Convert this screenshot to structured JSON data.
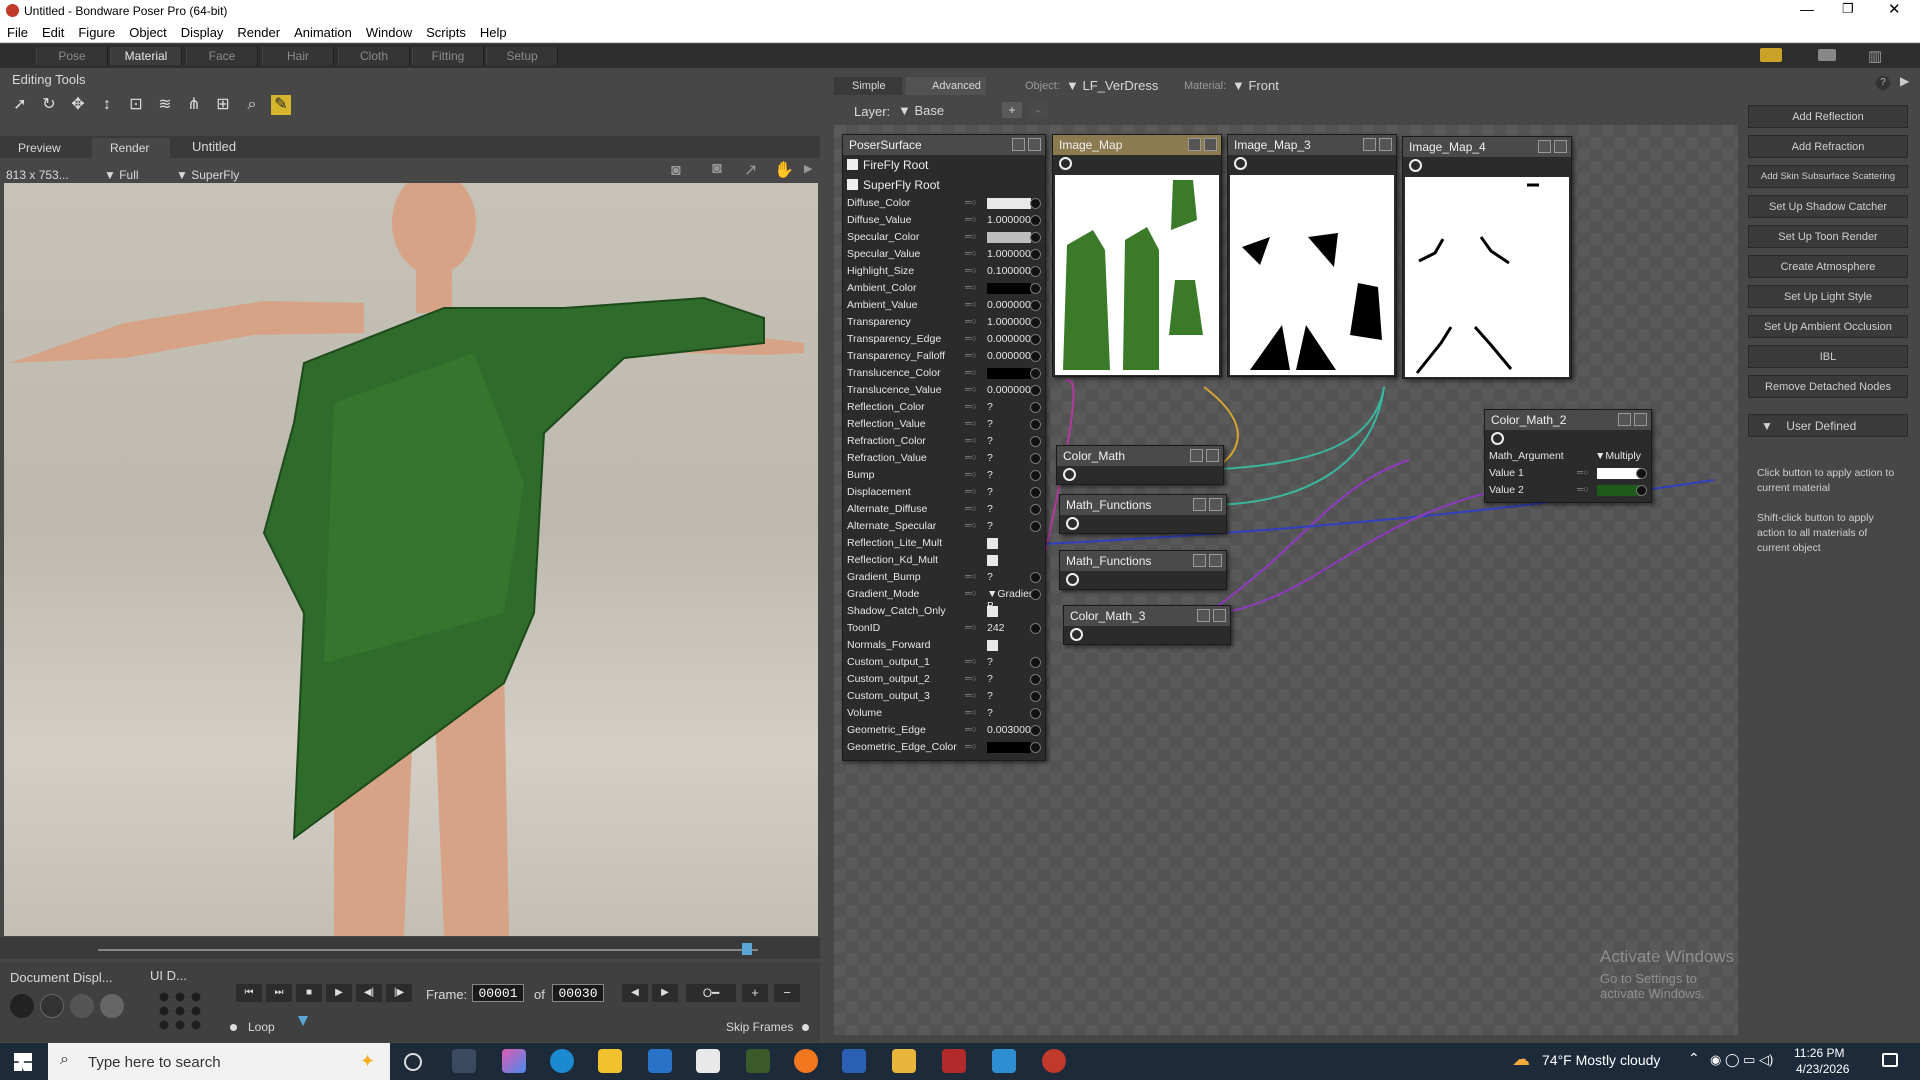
{
  "window": {
    "title": "Untitled - Bondware Poser Pro  (64-bit)"
  },
  "menu": [
    "File",
    "Edit",
    "Figure",
    "Object",
    "Display",
    "Render",
    "Animation",
    "Window",
    "Scripts",
    "Help"
  ],
  "rooms": [
    "Pose",
    "Material",
    "Face",
    "Hair",
    "Cloth",
    "Fitting",
    "Setup"
  ],
  "active_room": "Material",
  "editing_tools": {
    "label": "Editing Tools"
  },
  "doc_tabs": {
    "preview": "Preview",
    "render": "Render",
    "untitled": "Untitled"
  },
  "viewport": {
    "size": "813 x 753...",
    "mode": "Full",
    "renderer": "SuperFly"
  },
  "material_tabs": {
    "simple": "Simple",
    "advanced": "Advanced"
  },
  "object": {
    "label": "Object:",
    "value": "LF_VerDress"
  },
  "material": {
    "label": "Material:",
    "value": "Front"
  },
  "layer": {
    "label": "Layer:",
    "value": "Base"
  },
  "poser_surface": {
    "title": "PoserSurface",
    "firefly": "FireFly Root",
    "superfly": "SuperFly Root",
    "params": [
      {
        "name": "Diffuse_Color",
        "type": "color",
        "color": "#e8e8e8"
      },
      {
        "name": "Diffuse_Value",
        "value": "1.000000"
      },
      {
        "name": "Specular_Color",
        "type": "color",
        "color": "#bdbdbd"
      },
      {
        "name": "Specular_Value",
        "value": "1.000000"
      },
      {
        "name": "Highlight_Size",
        "value": "0.100000"
      },
      {
        "name": "Ambient_Color",
        "type": "color",
        "color": "#000000"
      },
      {
        "name": "Ambient_Value",
        "value": "0.000000"
      },
      {
        "name": "Transparency",
        "value": "1.000000"
      },
      {
        "name": "Transparency_Edge",
        "value": "0.000000"
      },
      {
        "name": "Transparency_Falloff",
        "value": "0.000000"
      },
      {
        "name": "Translucence_Color",
        "type": "color",
        "color": "#000000"
      },
      {
        "name": "Translucence_Value",
        "value": "0.000000"
      },
      {
        "name": "Reflection_Color",
        "value": "?"
      },
      {
        "name": "Reflection_Value",
        "value": "?"
      },
      {
        "name": "Refraction_Color",
        "value": "?"
      },
      {
        "name": "Refraction_Value",
        "value": "?"
      },
      {
        "name": "Bump",
        "value": "?"
      },
      {
        "name": "Displacement",
        "value": "?"
      },
      {
        "name": "Alternate_Diffuse",
        "value": "?"
      },
      {
        "name": "Alternate_Specular",
        "value": "?"
      },
      {
        "name": "Reflection_Lite_Mult",
        "type": "check"
      },
      {
        "name": "Reflection_Kd_Mult",
        "type": "check"
      },
      {
        "name": "Gradient_Bump",
        "value": "?"
      },
      {
        "name": "Gradient_Mode",
        "value": "▼Gradient B"
      },
      {
        "name": "Shadow_Catch_Only",
        "type": "check"
      },
      {
        "name": "ToonID",
        "value": "242"
      },
      {
        "name": "Normals_Forward",
        "type": "check"
      },
      {
        "name": "Custom_output_1",
        "value": "?"
      },
      {
        "name": "Custom_output_2",
        "value": "?"
      },
      {
        "name": "Custom_output_3",
        "value": "?"
      },
      {
        "name": "Volume",
        "value": "?"
      },
      {
        "name": "Geometric_Edge",
        "value": "0.003000"
      },
      {
        "name": "Geometric_Edge_Color",
        "type": "color",
        "color": "#000000"
      }
    ]
  },
  "nodes": {
    "image_map": "Image_Map",
    "image_map_3": "Image_Map_3",
    "image_map_4": "Image_Map_4",
    "color_math": "Color_Math",
    "math_functions_1": "Math_Functions",
    "math_functions_2": "Math_Functions",
    "color_math_3": "Color_Math_3",
    "color_math_2": {
      "title": "Color_Math_2",
      "arg_label": "Math_Argument",
      "arg_value": "▼Multiply",
      "value1": "Value 1",
      "value2": "Value 2"
    }
  },
  "wizards": [
    "Add Reflection",
    "Add Refraction",
    "Add Skin Subsurface Scattering",
    "Set Up Shadow Catcher",
    "Set Up Toon Render",
    "Create Atmosphere",
    "Set Up Light Style",
    "Set Up Ambient Occlusion",
    "IBL",
    "Remove Detached Nodes"
  ],
  "user_defined": "User Defined",
  "help": {
    "click": "Click button to apply action to current material",
    "shift": "Shift-click button to apply action to all materials of current object"
  },
  "bottom": {
    "document_display": "Document Displ...",
    "ui_dots": "UI D...",
    "frame_label": "Frame:",
    "frame": "00001",
    "of": "of",
    "total": "00030",
    "loop": "Loop",
    "skip": "Skip Frames"
  },
  "watermark": {
    "line1": "Activate Windows",
    "line2": "Go to Settings to activate Windows."
  },
  "taskbar": {
    "search": "Type here to search",
    "weather": "74°F  Mostly cloudy",
    "time": "11:26 PM",
    "date": "4/23/2026"
  }
}
